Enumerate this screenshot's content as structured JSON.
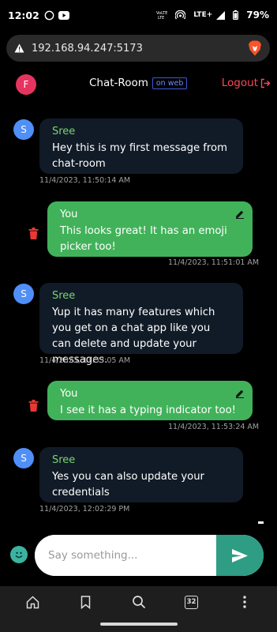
{
  "status_bar": {
    "time": "12:02",
    "network_label": "LTE+",
    "battery": "79%",
    "icons": [
      "whatsapp-icon",
      "youtube-icon",
      "volte-icon",
      "hotspot-icon",
      "signal-icon",
      "battery-icon"
    ]
  },
  "browser": {
    "url": "192.168.94.247:5173",
    "icons": [
      "warning-icon",
      "brave-lion-icon"
    ]
  },
  "header": {
    "user_initial": "F",
    "title": "Chat-Room",
    "badge": "on web",
    "logout_label": "Logout"
  },
  "messages": [
    {
      "type": "other",
      "avatar_initial": "S",
      "sender": "Sree",
      "text": "Hey this is my first message from chat-room",
      "timestamp": "11/4/2023, 11:50:14 AM"
    },
    {
      "type": "mine",
      "sender": "You",
      "text": "This looks great! It has an emoji picker too!",
      "timestamp": "11/4/2023, 11:51:01 AM"
    },
    {
      "type": "other",
      "avatar_initial": "S",
      "sender": "Sree",
      "text": "Yup it has many features which you get on a chat app like you can delete and update your messages.",
      "timestamp": "11/4/2023, 11:53:05 AM"
    },
    {
      "type": "mine",
      "sender": "You",
      "text": "I see it has a typing indicator too!",
      "timestamp": "11/4/2023, 11:53:24 AM"
    },
    {
      "type": "other",
      "avatar_initial": "S",
      "sender": "Sree",
      "text": "Yes you can also update your credentials",
      "timestamp": "11/4/2023, 12:02:29 PM"
    }
  ],
  "composer": {
    "placeholder": "Say something..."
  },
  "bottom_nav": {
    "tab_count": "32",
    "icons": [
      "home-icon",
      "bookmark-icon",
      "search-icon",
      "tabs-icon",
      "more-icon"
    ]
  },
  "colors": {
    "own_bubble": "#41b25a",
    "other_bubble": "#111b27",
    "sender_name": "#7ad46f",
    "logout": "#ff4757",
    "avatar_user": "#e6345f",
    "avatar_other": "#4f8ff7",
    "send_button": "#2f9c84"
  }
}
